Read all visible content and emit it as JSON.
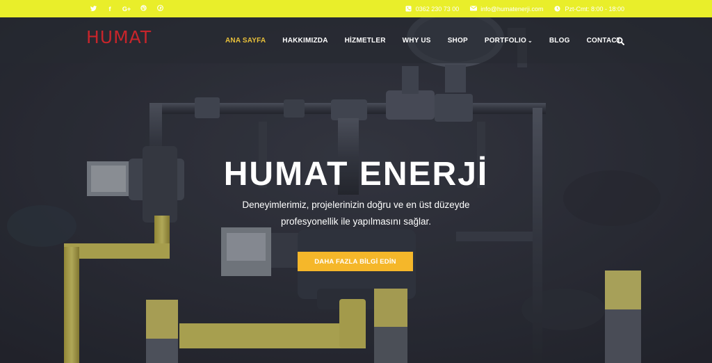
{
  "topbar": {
    "social": [
      "twitter-icon",
      "facebook-icon",
      "google-plus-icon",
      "dribbble-icon",
      "pinterest-icon"
    ],
    "social_glyphs": [
      "🐦",
      "f",
      "G+",
      "◎",
      "℗"
    ],
    "phone": "0362 230 73 00",
    "email": "info@humatenerji.com",
    "hours": "Pzt-Cmt: 8:00 - 18:00",
    "accent": "#e9ee2a"
  },
  "header": {
    "logo": "HUMAT",
    "nav": [
      {
        "label": "ANA SAYFA"
      },
      {
        "label": "HAKKIMIZDA"
      },
      {
        "label": "HİZMETLER"
      },
      {
        "label": "WHY US"
      },
      {
        "label": "SHOP"
      },
      {
        "label": "PORTFOLIO"
      },
      {
        "label": "BLOG"
      },
      {
        "label": "CONTACT"
      }
    ],
    "logo_color": "#c7252b",
    "active_color": "#e9c13a"
  },
  "hero": {
    "title": "HUMAT ENERJİ",
    "subtitle_line1": "Deneyimlerimiz, projelerinizin doğru ve en üst düzeyde",
    "subtitle_line2": "profesyonellik ile yapılmasını sağlar.",
    "cta": "DAHA FAZLA BİLGİ EDİN",
    "cta_color": "#f5b72a"
  }
}
